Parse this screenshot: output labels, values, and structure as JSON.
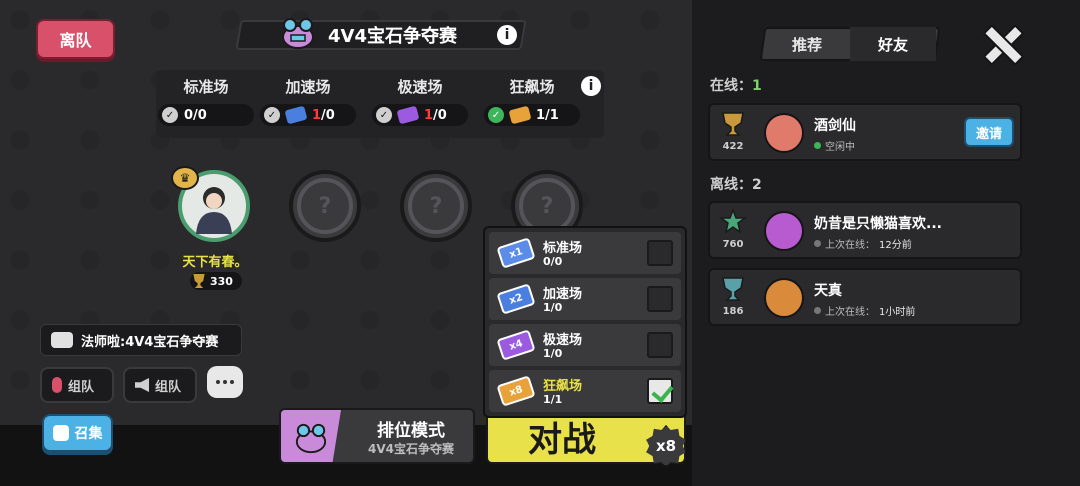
{
  "left_panel": {
    "leave_button": "离队",
    "mode_title": "4V4宝石争夺赛",
    "stages": [
      {
        "name": "标准场",
        "progress_done": "0",
        "progress_total": "/0",
        "completed": true
      },
      {
        "name": "加速场",
        "progress_done": "1",
        "progress_total": "/0",
        "completed": true
      },
      {
        "name": "极速场",
        "progress_done": "1",
        "progress_total": "/0",
        "completed": true
      },
      {
        "name": "狂飙场",
        "progress_done": "1",
        "progress_total": "/1",
        "completed": true
      }
    ],
    "player": {
      "name": "天下有春。",
      "trophies": "330"
    },
    "chat_message": "法师啦:4V4宝石争夺赛",
    "buttons": {
      "team_voice": "组队",
      "team_speaker": "组队",
      "summon": "召集"
    },
    "rank_mode": {
      "title": "排位模式",
      "subtitle": "4V4宝石争夺赛"
    },
    "battle_button": "对战",
    "battle_multiplier": "x8"
  },
  "popup": {
    "items": [
      {
        "name": "标准场",
        "progress": "0/0",
        "ticket_label": "x1",
        "ticket_color": "#5b8de8",
        "checked": false
      },
      {
        "name": "加速场",
        "progress": "1/0",
        "ticket_label": "x2",
        "ticket_color": "#4a7fe0",
        "checked": false
      },
      {
        "name": "极速场",
        "progress": "1/0",
        "ticket_label": "x4",
        "ticket_color": "#9b5ae0",
        "checked": false
      },
      {
        "name": "狂飙场",
        "progress": "1/1",
        "ticket_label": "x8",
        "ticket_color": "#e8a23a",
        "checked": true
      }
    ]
  },
  "friends_panel": {
    "tabs": [
      "推荐",
      "好友"
    ],
    "active_tab": "好友",
    "online_label": "在线：",
    "online_count": "1",
    "offline_label": "离线：",
    "offline_count": "2",
    "online": [
      {
        "name": "酒剑仙",
        "trophies": "422",
        "status": "空闲中",
        "invite": "邀请",
        "avatar_color": "#e07a6a"
      }
    ],
    "offline": [
      {
        "name": "奶昔是只懒猫喜欢...",
        "trophies": "760",
        "status_prefix": "上次在线：",
        "status_value": "12分前",
        "avatar_color": "#b85ad0"
      },
      {
        "name": "天真",
        "trophies": "186",
        "status_prefix": "上次在线：",
        "status_value": "1小时前",
        "avatar_color": "#d98a3a"
      }
    ]
  },
  "colors": {
    "accent_yellow": "#e8e14a",
    "leave_red": "#d9506a",
    "invite_blue": "#4cb2e6",
    "online_green": "#3db55a"
  }
}
